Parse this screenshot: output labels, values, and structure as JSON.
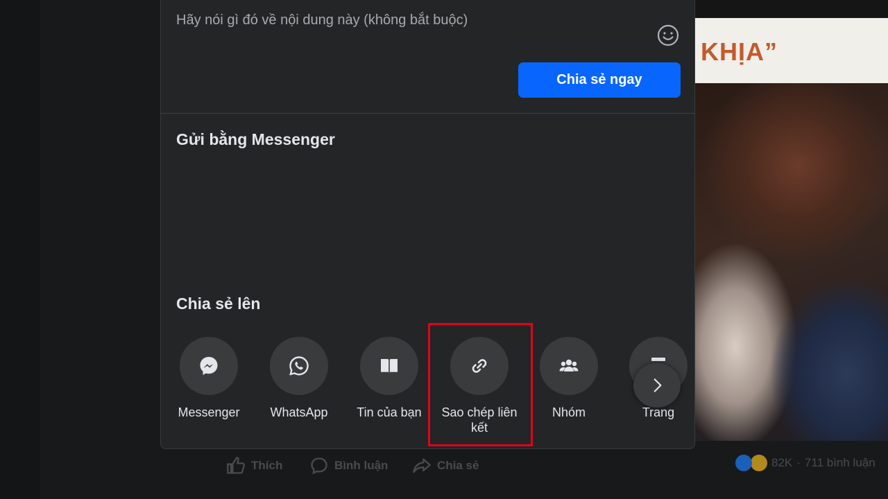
{
  "post": {
    "banner_text": "KHỊA”",
    "actions": {
      "like_label": "Thích",
      "comment_label": "Bình luận",
      "share_label": "Chia sẻ"
    },
    "reaction_count": "82K",
    "comment_count": "711 bình luận",
    "separator": "·"
  },
  "modal": {
    "composer_placeholder": "Hãy nói gì đó về nội dung này (không bắt buộc)",
    "share_now_label": "Chia sẻ ngay",
    "messenger_section_title": "Gửi bằng Messenger",
    "share_to_section_title": "Chia sẻ lên",
    "share_targets": [
      {
        "label": "Messenger",
        "icon": "messenger-icon"
      },
      {
        "label": "WhatsApp",
        "icon": "whatsapp-icon"
      },
      {
        "label": "Tin của bạn",
        "icon": "story-book-icon"
      },
      {
        "label": "Sao chép liên kết",
        "icon": "link-icon"
      },
      {
        "label": "Nhóm",
        "icon": "group-icon"
      },
      {
        "label": "Trang",
        "icon": "page-flag-icon"
      }
    ]
  },
  "colors": {
    "primary_button": "#0866ff",
    "modal_bg": "#242526",
    "highlight": "#e3001b"
  }
}
